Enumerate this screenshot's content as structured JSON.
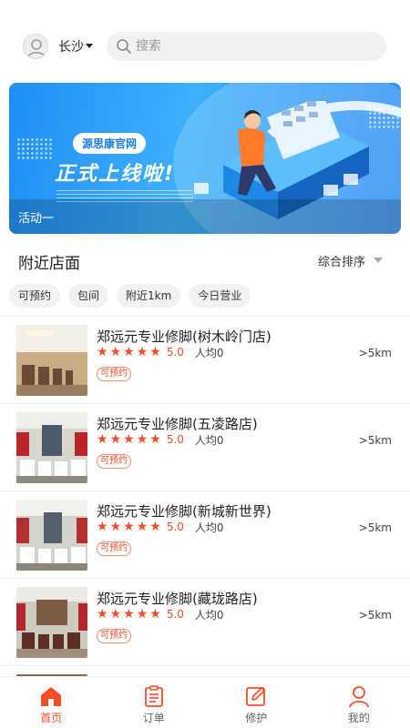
{
  "header": {
    "city": "长沙",
    "search_placeholder": "搜索"
  },
  "banner": {
    "pill": "源思康官网",
    "headline": "正式上线啦!",
    "caption": "活动一"
  },
  "nearby": {
    "title": "附近店面",
    "sort_label": "综合排序",
    "filters": [
      "可预约",
      "包间",
      "附近1km",
      "今日营业"
    ]
  },
  "stores": [
    {
      "name": "郑远元专业修脚(树木岭门店)",
      "rating": "5.0",
      "avg": "人均0",
      "tag": "可预约",
      "distance": ">5km",
      "stars": 5
    },
    {
      "name": "郑远元专业修脚(五凌路店)",
      "rating": "5.0",
      "avg": "人均0",
      "tag": "可预约",
      "distance": ">5km",
      "stars": 5
    },
    {
      "name": "郑远元专业修脚(新城新世界)",
      "rating": "5.0",
      "avg": "人均0",
      "tag": "可预约",
      "distance": ">5km",
      "stars": 5
    },
    {
      "name": "郑远元专业修脚(藏珑路店)",
      "rating": "5.0",
      "avg": "人均0",
      "tag": "可预约",
      "distance": ">5km",
      "stars": 5
    }
  ],
  "tabs": [
    {
      "label": "首页",
      "icon": "home-icon",
      "active": true
    },
    {
      "label": "订单",
      "icon": "order-icon",
      "active": false
    },
    {
      "label": "修护",
      "icon": "edit-icon",
      "active": false
    },
    {
      "label": "我的",
      "icon": "profile-icon",
      "active": false
    }
  ],
  "colors": {
    "accent": "#f24d29",
    "banner_blue": "#2a8cf3"
  }
}
